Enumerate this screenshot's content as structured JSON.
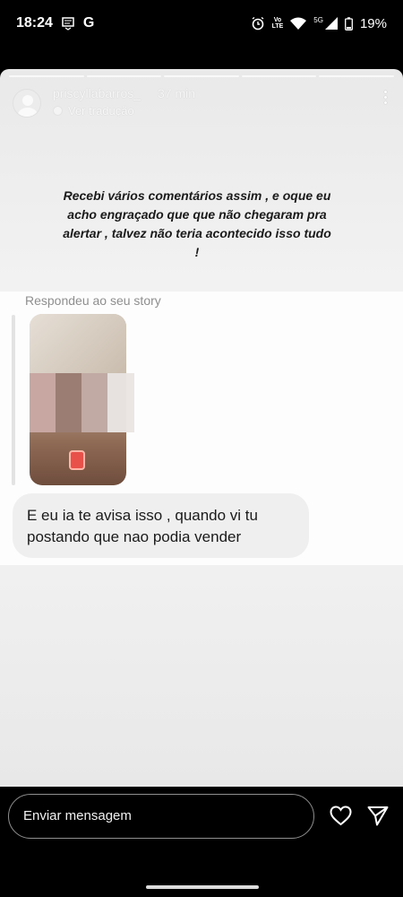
{
  "status_bar": {
    "time": "18:24",
    "google_letter": "G",
    "signal_label": "5G",
    "volte_label": "Vo",
    "lte_label": "LTE",
    "battery": "19%"
  },
  "story": {
    "progress_segments": 5,
    "username": "priscyllabarros_",
    "time_ago": "37 min",
    "translate_label": "Ver tradução",
    "caption": "Recebi vários comentários assim , e oque eu acho engraçado que que não chegaram pra alertar , talvez não teria acontecido isso tudo !"
  },
  "reply": {
    "label": "Respondeu ao seu story",
    "message": "E eu ia te avisa isso , quando vi tu postando que nao podia vender"
  },
  "bottom_bar": {
    "input_placeholder": "Enviar mensagem",
    "heart_icon": "heart-icon",
    "send_icon": "send-icon"
  }
}
